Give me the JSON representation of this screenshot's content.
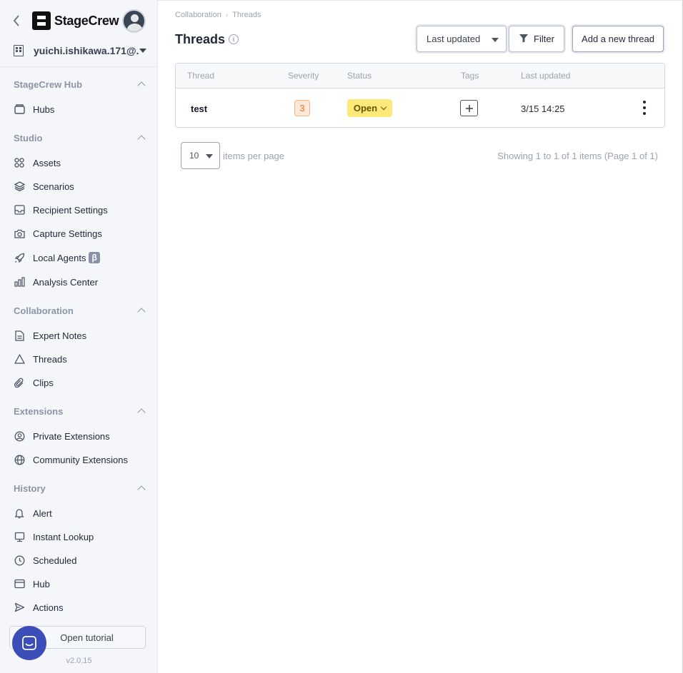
{
  "app": {
    "logo_text": "StageCrew",
    "account_label": "yuichi.ishikawa.171@...",
    "version": "v2.0.15",
    "tutorial_label": "Open tutorial"
  },
  "sidebar": {
    "sections": [
      {
        "title": "StageCrew Hub",
        "items": [
          {
            "label": "Hubs",
            "icon": "inbox-icon"
          }
        ]
      },
      {
        "title": "Studio",
        "items": [
          {
            "label": "Assets",
            "icon": "grid-icon"
          },
          {
            "label": "Scenarios",
            "icon": "layers-icon"
          },
          {
            "label": "Recipient Settings",
            "icon": "inbox-tray-icon"
          },
          {
            "label": "Capture Settings",
            "icon": "camera-icon"
          },
          {
            "label": "Local Agents",
            "icon": "rocket-icon",
            "badge": "β"
          },
          {
            "label": "Analysis Center",
            "icon": "bar-chart-icon"
          }
        ]
      },
      {
        "title": "Collaboration",
        "items": [
          {
            "label": "Expert Notes",
            "icon": "document-icon"
          },
          {
            "label": "Threads",
            "icon": "warning-triangle-icon"
          },
          {
            "label": "Clips",
            "icon": "paperclip-icon"
          }
        ]
      },
      {
        "title": "Extensions",
        "items": [
          {
            "label": "Private Extensions",
            "icon": "user-circle-icon"
          },
          {
            "label": "Community Extensions",
            "icon": "globe-icon"
          }
        ]
      },
      {
        "title": "History",
        "items": [
          {
            "label": "Alert",
            "icon": "bell-icon"
          },
          {
            "label": "Instant Lookup",
            "icon": "monitor-icon"
          },
          {
            "label": "Scheduled",
            "icon": "clock-icon"
          },
          {
            "label": "Hub",
            "icon": "window-icon"
          },
          {
            "label": "Actions",
            "icon": "send-icon"
          }
        ]
      }
    ]
  },
  "header": {
    "breadcrumb": [
      "Collaboration",
      "Threads"
    ],
    "title": "Threads",
    "sort_value": "Last updated",
    "filter_label": "Filter",
    "add_label": "Add a new thread"
  },
  "table": {
    "columns": [
      "Thread",
      "Severity",
      "Status",
      "Tags",
      "Last updated"
    ],
    "rows": [
      {
        "thread": "test",
        "severity": "3",
        "status": "Open",
        "last_updated": "3/15 14:25"
      }
    ]
  },
  "pagination": {
    "page_size": "10",
    "page_size_label": "items per page",
    "summary": "Showing 1 to 1 of 1 items (Page 1 of 1)"
  },
  "colors": {
    "accent": "#3b4db8",
    "status_open_bg": "#fce97a",
    "severity_bg": "#fde8d7"
  }
}
